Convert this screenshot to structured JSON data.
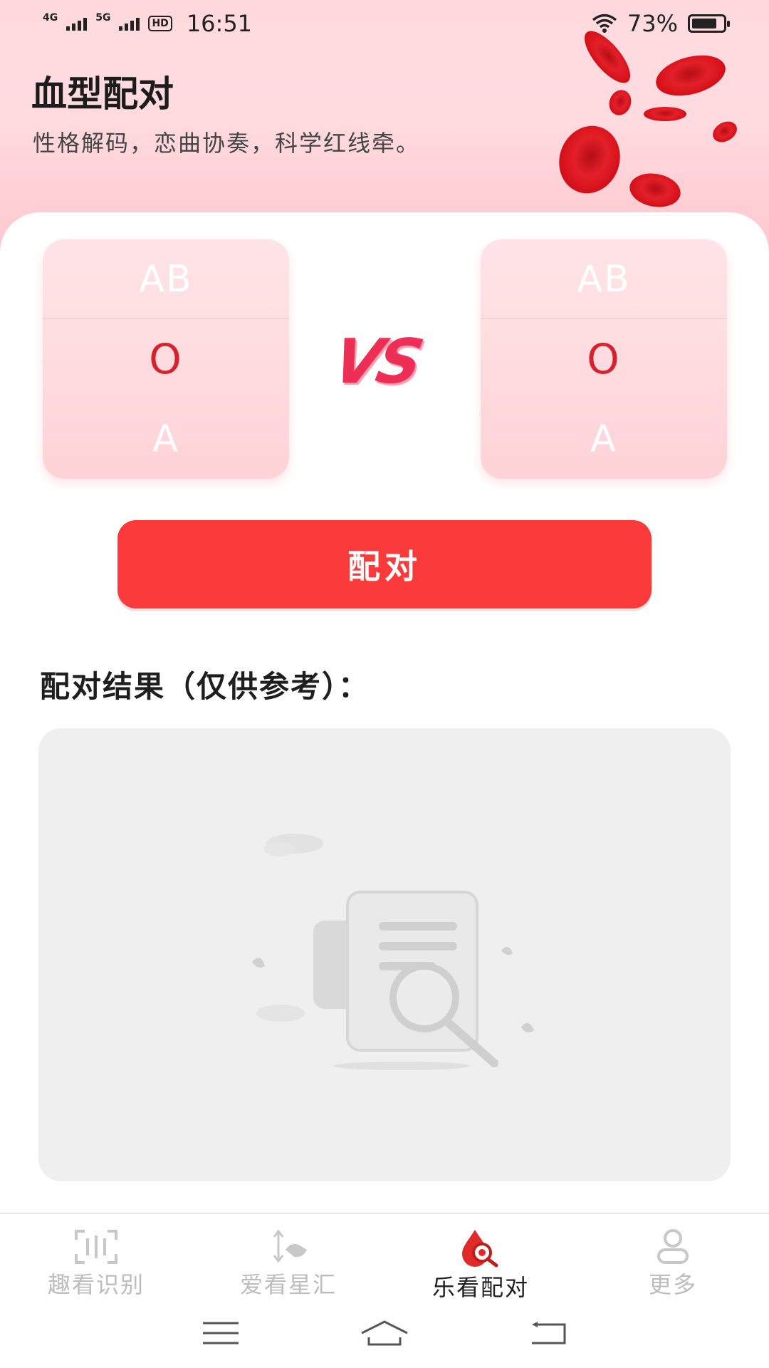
{
  "status": {
    "net1": "4G",
    "net2": "5G",
    "hd": "HD",
    "time": "16:51",
    "battery": "73%"
  },
  "header": {
    "title": "血型配对",
    "subtitle": "性格解码，恋曲协奏，科学红线牵。"
  },
  "picker_left": {
    "above": "AB",
    "selected": "O",
    "below": "A"
  },
  "picker_right": {
    "above": "AB",
    "selected": "O",
    "below": "A"
  },
  "vs_label": "VS",
  "match_button": "配对",
  "result_label": "配对结果（仅供参考）：",
  "nav": [
    {
      "label": "趣看识别",
      "icon": "scan-icon",
      "active": false
    },
    {
      "label": "爱看星汇",
      "icon": "star-sort-icon",
      "active": false
    },
    {
      "label": "乐看配对",
      "icon": "blood-drop-search-icon",
      "active": true
    },
    {
      "label": "更多",
      "icon": "person-icon",
      "active": false
    }
  ],
  "colors": {
    "accent": "#fa3a3b",
    "header_bg": "#ffd9de",
    "selected_text": "#d6222c"
  }
}
